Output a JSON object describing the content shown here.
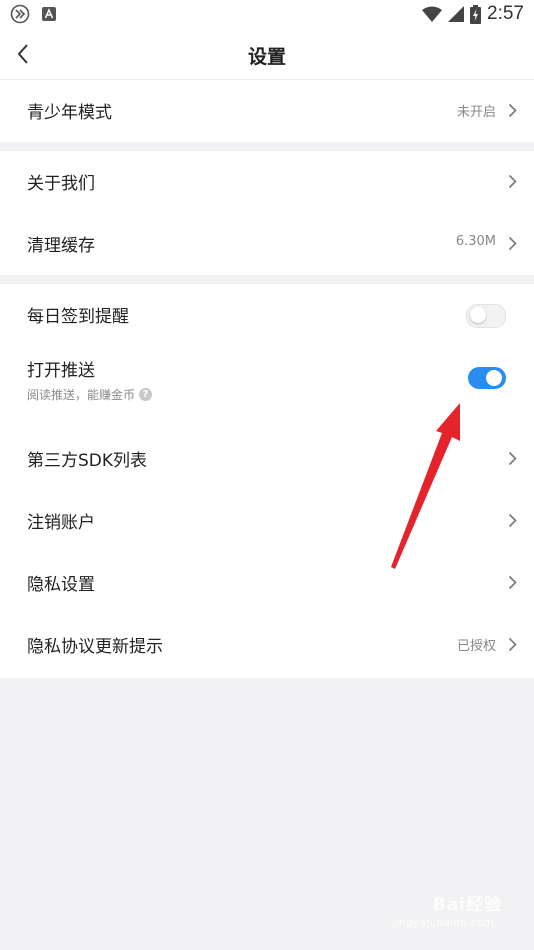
{
  "status_bar": {
    "time": "2:57",
    "left_icons": [
      "media-skip-icon",
      "keyboard-a-icon"
    ],
    "right_icons": [
      "wifi-icon",
      "signal-icon",
      "battery-charging-icon"
    ]
  },
  "header": {
    "title": "设置",
    "back_icon": "chevron-left-icon"
  },
  "sections": [
    {
      "items": [
        {
          "label": "青少年模式",
          "value": "未开启",
          "chevron": true
        }
      ]
    },
    {
      "items": [
        {
          "label": "关于我们",
          "chevron": true
        },
        {
          "label": "清理缓存",
          "value": "6.30M",
          "chevron": true
        }
      ]
    },
    {
      "items": [
        {
          "label": "每日签到提醒",
          "toggle": false
        },
        {
          "label": "打开推送",
          "subtitle": "阅读推送，能赚金币",
          "help_icon": "?",
          "toggle": true
        },
        {
          "label": "第三方SDK列表",
          "chevron": true
        },
        {
          "label": "注销账户",
          "chevron": true
        },
        {
          "label": "隐私设置",
          "chevron": true
        },
        {
          "label": "隐私协议更新提示",
          "value": "已授权",
          "chevron": true
        }
      ]
    }
  ],
  "watermark": {
    "text": "Bai经验",
    "sub": "jingyan.baidu.com"
  },
  "colors": {
    "accent": "#2b8cf0",
    "annotation_arrow": "#e5232b",
    "background": "#f2f2f4",
    "row_bg": "#ffffff"
  }
}
